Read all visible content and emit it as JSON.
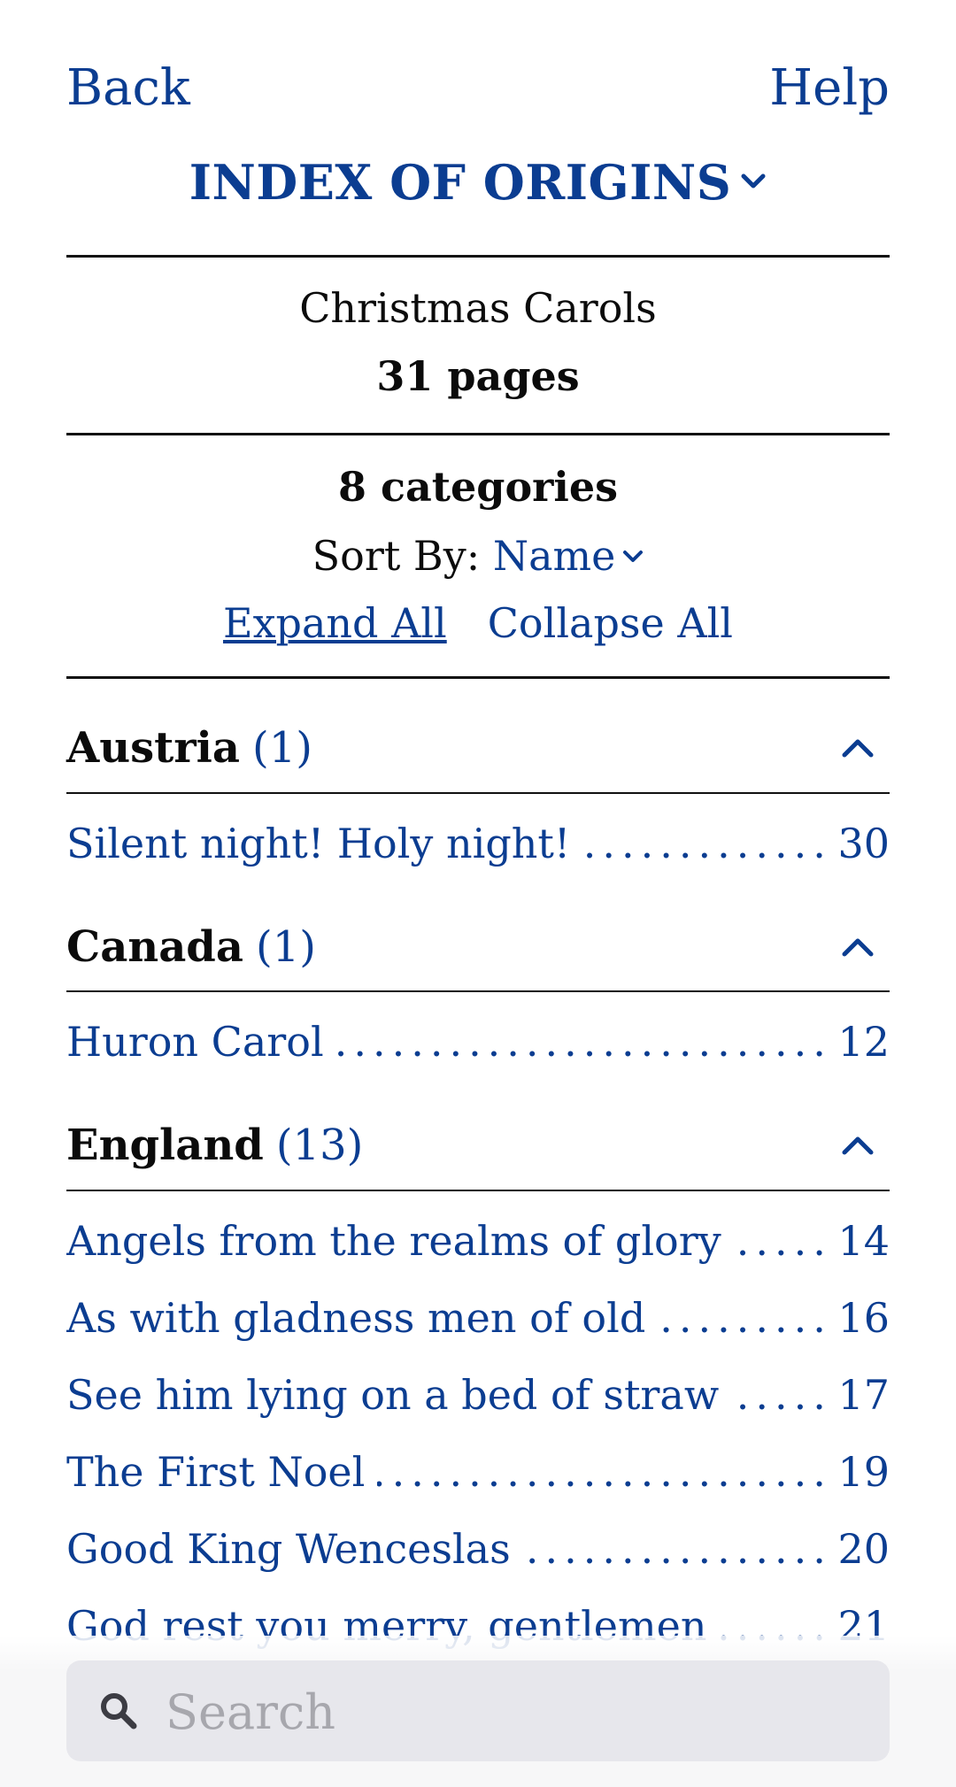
{
  "nav": {
    "back_label": "Back",
    "help_label": "Help"
  },
  "index": {
    "title": "INDEX OF ORIGINS"
  },
  "book": {
    "title": "Christmas Carols",
    "pages": "31 pages"
  },
  "summary": {
    "categories": "8 categories",
    "sort_label": "Sort By:",
    "sort_value": "Name",
    "expand_all": "Expand All",
    "collapse_all": "Collapse All"
  },
  "categories": [
    {
      "name": "Austria",
      "count": "(1)",
      "entries": [
        {
          "title": "Silent night! Holy night!",
          "page": "30"
        }
      ]
    },
    {
      "name": "Canada",
      "count": "(1)",
      "entries": [
        {
          "title": "Huron Carol",
          "page": "12"
        }
      ]
    },
    {
      "name": "England",
      "count": "(13)",
      "entries": [
        {
          "title": "Angels from the realms of glory",
          "page": "14"
        },
        {
          "title": "As with gladness men of old",
          "page": "16"
        },
        {
          "title": "See him lying on a bed of straw",
          "page": "17"
        },
        {
          "title": "The First Noel",
          "page": "19"
        },
        {
          "title": "Good King Wenceslas",
          "page": "20"
        },
        {
          "title": "God rest you merry, gentlemen",
          "page": "21"
        }
      ]
    }
  ],
  "search": {
    "placeholder": "Search"
  },
  "colors": {
    "link": "#0b3d91",
    "search_field": "#e7e7ec"
  }
}
